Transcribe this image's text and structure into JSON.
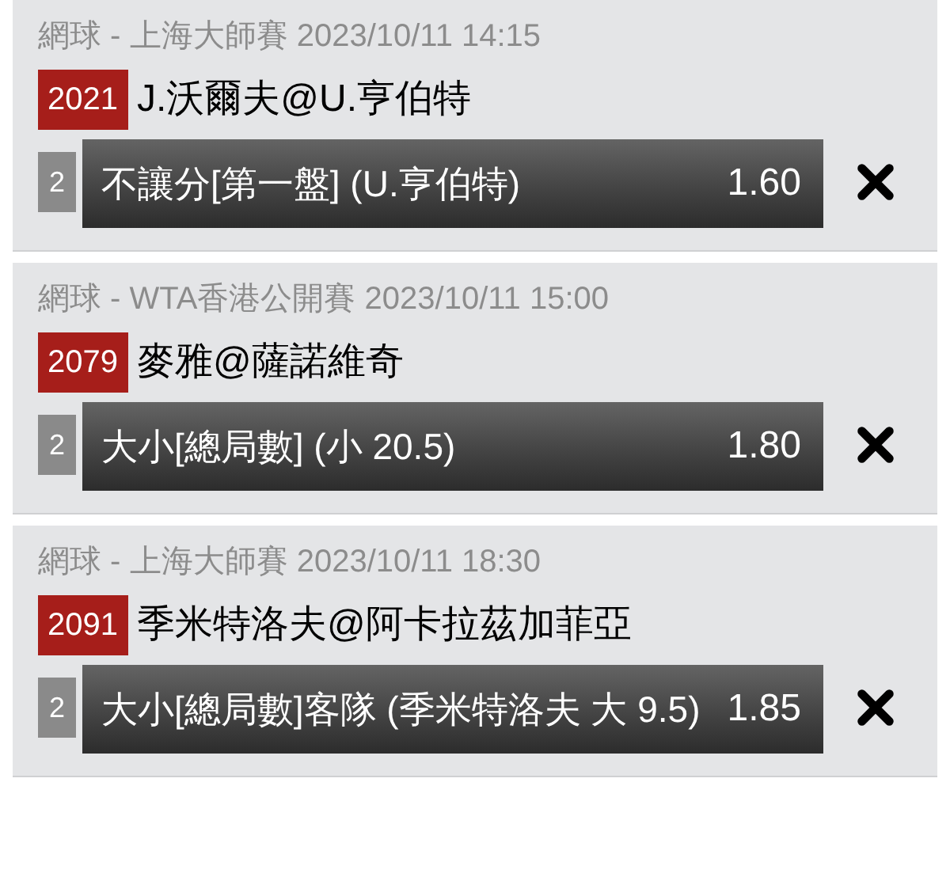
{
  "bets": [
    {
      "league": "網球 - 上海大師賽 2023/10/11 14:15",
      "code": "2021",
      "match": "J.沃爾夫@U.亨伯特",
      "slot": "2",
      "selection": "不讓分[第一盤] (U.亨伯特)",
      "odds": "1.60"
    },
    {
      "league": "網球 - WTA香港公開賽 2023/10/11 15:00",
      "code": "2079",
      "match": "麥雅@薩諾維奇",
      "slot": "2",
      "selection": "大小[總局數] (小 20.5)",
      "odds": "1.80"
    },
    {
      "league": "網球 - 上海大師賽 2023/10/11 18:30",
      "code": "2091",
      "match": "季米特洛夫@阿卡拉茲加菲亞",
      "slot": "2",
      "selection": "大小[總局數]客隊 (季米特洛夫 大 9.5)",
      "odds": "1.85"
    }
  ]
}
